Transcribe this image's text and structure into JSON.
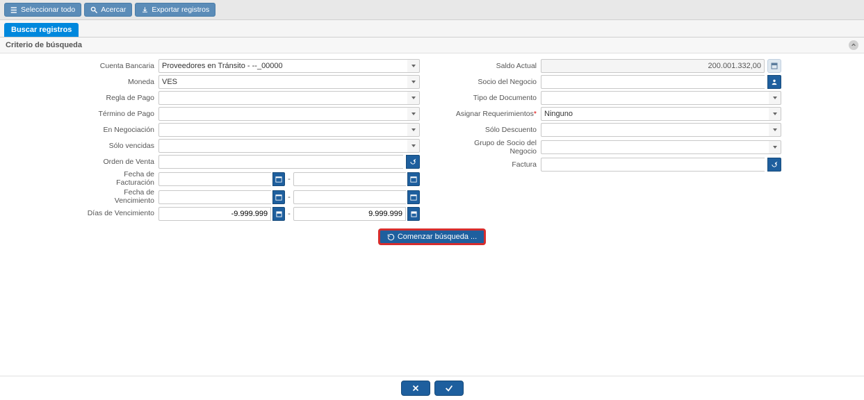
{
  "toolbar": {
    "select_all": "Seleccionar todo",
    "zoom": "Acercar",
    "export": "Exportar registros"
  },
  "tabs": {
    "search": "Buscar registros"
  },
  "panel": {
    "title": "Criterio de búsqueda"
  },
  "labels": {
    "cuenta_bancaria": "Cuenta Bancaria",
    "moneda": "Moneda",
    "regla_pago": "Regla de Pago",
    "termino_pago": "Término de Pago",
    "en_negociacion": "En Negociación",
    "solo_vencidas": "Sólo vencidas",
    "orden_venta": "Orden de Venta",
    "fecha_facturacion": "Fecha de Facturación",
    "fecha_vencimiento": "Fecha de Vencimiento",
    "dias_vencimiento": "Días de Vencimiento",
    "saldo_actual": "Saldo Actual",
    "socio_negocio": "Socio del Negocio",
    "tipo_documento": "Tipo de Documento",
    "asignar_req": "Asignar Requerimientos",
    "solo_descuento": "Sólo Descuento",
    "grupo_socio": "Grupo de Socio del Negocio",
    "factura": "Factura"
  },
  "values": {
    "cuenta_bancaria": "Proveedores en Tránsito - --_00000",
    "moneda": "VES",
    "regla_pago": "",
    "termino_pago": "",
    "en_negociacion": "",
    "solo_vencidas": "",
    "orden_venta": "",
    "fecha_fact_from": "",
    "fecha_fact_to": "",
    "fecha_venc_from": "",
    "fecha_venc_to": "",
    "dias_from": "-9.999.999",
    "dias_to": "9.999.999",
    "saldo_actual": "200.001.332,00",
    "socio_negocio": "",
    "tipo_documento": "",
    "asignar_req": "Ninguno",
    "solo_descuento": "",
    "grupo_socio": "",
    "factura": ""
  },
  "actions": {
    "search": "Comenzar búsqueda ..."
  },
  "range_sep": "-"
}
